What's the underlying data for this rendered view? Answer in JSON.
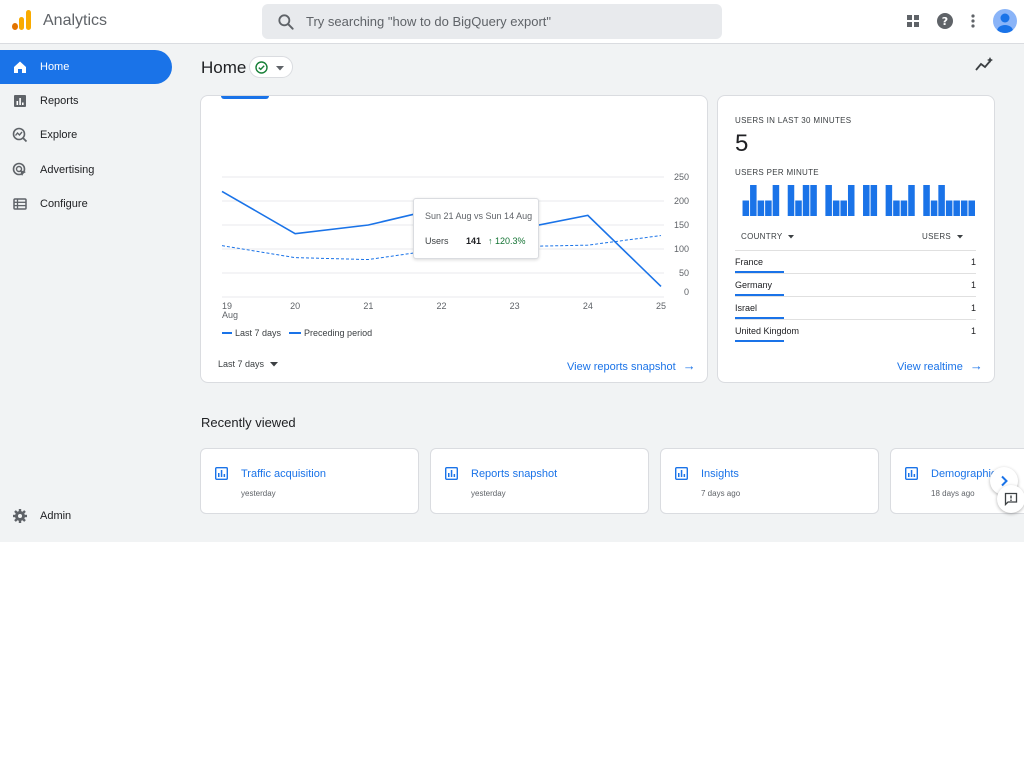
{
  "app": {
    "title": "Analytics"
  },
  "search": {
    "placeholder": "Try searching \"how to do BigQuery export\""
  },
  "sidebar": {
    "items": [
      {
        "label": "Home",
        "icon": "home-icon",
        "active": true
      },
      {
        "label": "Reports",
        "icon": "bar-chart-icon"
      },
      {
        "label": "Explore",
        "icon": "explore-icon"
      },
      {
        "label": "Advertising",
        "icon": "advertising-icon"
      },
      {
        "label": "Configure",
        "icon": "configure-icon"
      }
    ],
    "admin_label": "Admin"
  },
  "page": {
    "title": "Home"
  },
  "overview": {
    "tooltip": {
      "title": "Sun 21 Aug vs Sun 14 Aug",
      "metric": "Users",
      "value": "141",
      "change": "120.3%"
    },
    "legend": {
      "current": "Last 7 days",
      "previous": "Preceding period"
    },
    "range_label": "Last 7 days",
    "link": "View reports snapshot"
  },
  "chart_data": {
    "type": "line",
    "x": [
      "19",
      "20",
      "21",
      "22",
      "23",
      "24",
      "25"
    ],
    "x_first_sub": "Aug",
    "yticks": [
      0,
      50,
      100,
      150,
      200,
      250
    ],
    "ylim": [
      0,
      250
    ],
    "series": [
      {
        "name": "Last 7 days",
        "values": [
          220,
          132,
          150,
          186,
          140,
          170,
          22
        ],
        "style": "solid"
      },
      {
        "name": "Preceding period",
        "values": [
          107,
          82,
          78,
          100,
          105,
          108,
          128
        ],
        "style": "dashed"
      }
    ],
    "colors": {
      "primary": "#1a73e8",
      "grid": "#e8eaed"
    }
  },
  "realtime": {
    "heading": "USERS IN LAST 30 MINUTES",
    "value": "5",
    "per_minute_label": "USERS PER MINUTE",
    "per_minute": [
      0,
      1,
      2,
      1,
      1,
      2,
      0,
      2,
      1,
      2,
      2,
      0,
      2,
      1,
      1,
      2,
      0,
      2,
      2,
      0,
      2,
      1,
      1,
      2,
      0,
      2,
      1,
      2,
      1,
      1,
      1,
      1
    ],
    "col_country": "COUNTRY",
    "col_users": "USERS",
    "rows": [
      {
        "country": "France",
        "users": "1"
      },
      {
        "country": "Germany",
        "users": "1"
      },
      {
        "country": "Israel",
        "users": "1"
      },
      {
        "country": "United Kingdom",
        "users": "1"
      }
    ],
    "link": "View realtime"
  },
  "recent": {
    "title": "Recently viewed",
    "items": [
      {
        "title": "Traffic acquisition",
        "sub": "yesterday"
      },
      {
        "title": "Reports snapshot",
        "sub": "yesterday"
      },
      {
        "title": "Insights",
        "sub": "7 days ago"
      },
      {
        "title": "Demographic",
        "sub": "18 days ago"
      }
    ]
  }
}
